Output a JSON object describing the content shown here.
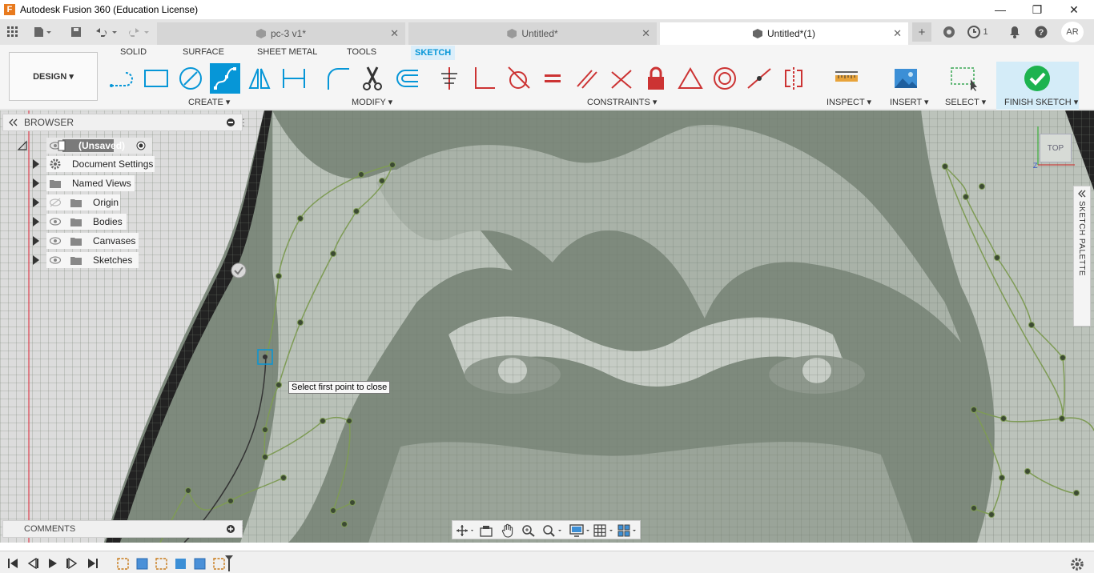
{
  "window": {
    "title": "Autodesk Fusion 360 (Education License)"
  },
  "tabs": [
    {
      "label": "pc-3 v1*"
    },
    {
      "label": "Untitled*"
    },
    {
      "label": "Untitled*(1)"
    }
  ],
  "tabbar": {
    "jobs_count": "1",
    "user_initials": "AR"
  },
  "workspace": {
    "label": "DESIGN ▾"
  },
  "ribbon_tabs": [
    "SOLID",
    "SURFACE",
    "SHEET METAL",
    "TOOLS",
    "SKETCH"
  ],
  "groups": {
    "create": "CREATE ▾",
    "modify": "MODIFY ▾",
    "constraints": "CONSTRAINTS ▾",
    "inspect": "INSPECT ▾",
    "insert": "INSERT ▾",
    "select": "SELECT ▾",
    "finish": "FINISH SKETCH ▾"
  },
  "browser": {
    "title": "BROWSER",
    "root": "(Unsaved)",
    "items": [
      "Document Settings",
      "Named Views",
      "Origin",
      "Bodies",
      "Canvases",
      "Sketches"
    ]
  },
  "comments": {
    "label": "COMMENTS"
  },
  "tooltip": "Select first point to close",
  "palette": {
    "label": "SKETCH PALETTE"
  },
  "viewcube": {
    "label": "TOP"
  },
  "colors": {
    "accent": "#0696d7",
    "finish_green": "#1db34f",
    "sketch_line": "#7e9b55"
  }
}
